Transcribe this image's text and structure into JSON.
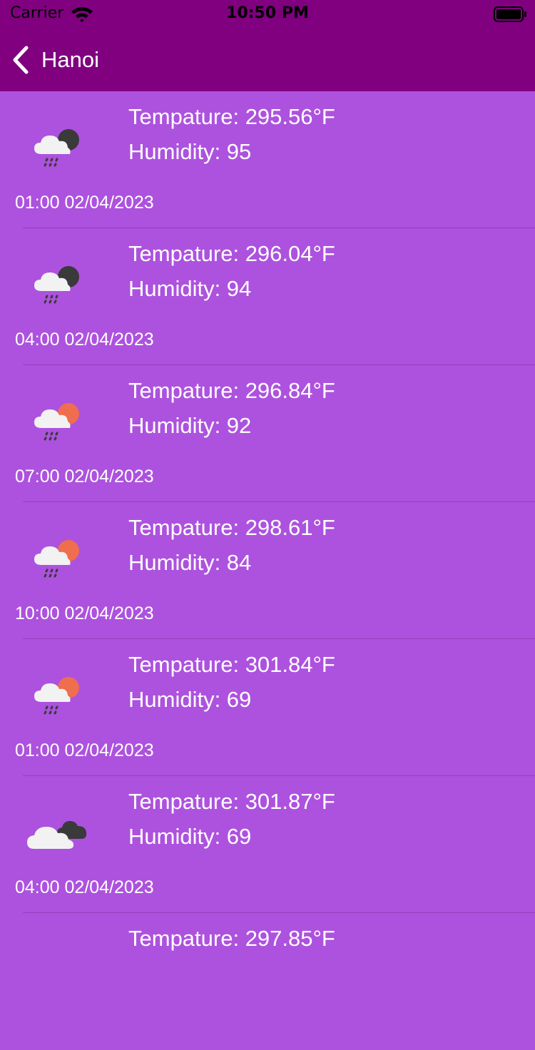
{
  "status_bar": {
    "carrier": "Carrier",
    "time": "10:50 PM"
  },
  "nav": {
    "title": "Hanoi",
    "back_icon": "chevron-left-icon"
  },
  "items": [
    {
      "temperature": "Tempature: 295.56°F",
      "humidity": "Humidity: 95",
      "time": "01:00 02/04/2023",
      "icon": "night-rain-icon"
    },
    {
      "temperature": "Tempature: 296.04°F",
      "humidity": "Humidity: 94",
      "time": "04:00 02/04/2023",
      "icon": "night-rain-icon"
    },
    {
      "temperature": "Tempature: 296.84°F",
      "humidity": "Humidity: 92",
      "time": "07:00 02/04/2023",
      "icon": "day-rain-icon"
    },
    {
      "temperature": "Tempature: 298.61°F",
      "humidity": "Humidity: 84",
      "time": "10:00 02/04/2023",
      "icon": "day-rain-icon"
    },
    {
      "temperature": "Tempature: 301.84°F",
      "humidity": "Humidity: 69",
      "time": "01:00 02/04/2023",
      "icon": "day-rain-icon"
    },
    {
      "temperature": "Tempature: 301.87°F",
      "humidity": "Humidity: 69",
      "time": "04:00 02/04/2023",
      "icon": "broken-clouds-icon"
    },
    {
      "temperature": "Tempature: 297.85°F",
      "humidity": "",
      "time": "",
      "icon": ""
    }
  ],
  "colors": {
    "nav_background": "#800080",
    "list_background": "#ad52de",
    "text": "#ffffff",
    "moon": "#3a3a3a",
    "sun": "#ee6e4e"
  }
}
